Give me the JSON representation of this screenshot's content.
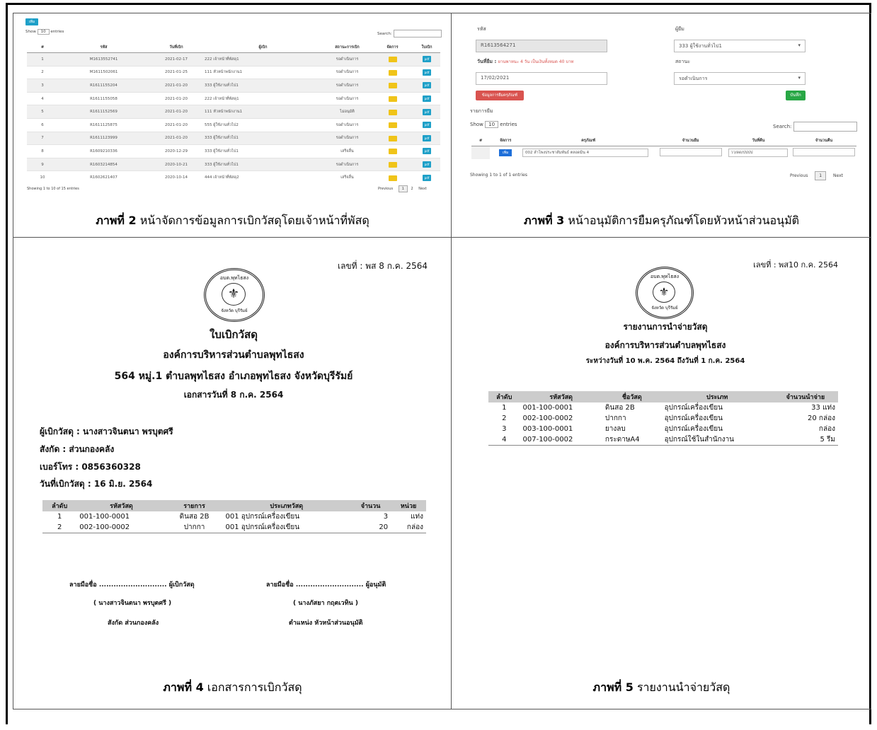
{
  "captions": [
    {
      "num": "ภาพที่ 2",
      "text": " หน้าจัดการข้อมูลการเบิกวัสดุโดยเจ้าหน้าที่พัสดุ"
    },
    {
      "num": "ภาพที่ 3",
      "text": " หน้าอนุมัติการยืมครุภัณฑ์โดยหัวหน้าส่วนอนุมัติ"
    },
    {
      "num": "ภาพที่ 4",
      "text": " เอกสารการเบิกวัสดุ"
    },
    {
      "num": "ภาพที่ 5",
      "text": " รายงานนำจ่ายวัสดุ"
    }
  ],
  "fig2": {
    "add_button": "เพิ่ม",
    "show_label": "Show",
    "show_value": "10",
    "entries_label": "entries",
    "search_label": "Search:",
    "columns": [
      "#",
      "รหัส",
      "วันที่เบิก",
      "ผู้เบิก",
      "สถานะการเบิก",
      "จัดการ",
      "ใบเบิก"
    ],
    "rows": [
      [
        "1",
        "M1613552741",
        "2021-02-17",
        "222 เจ้าหน้าที่พัสดุ1",
        "รอดำเนินการ"
      ],
      [
        "2",
        "M1611502061",
        "2021-01-25",
        "111 หัวหน้าพนักงาน1",
        "รอดำเนินการ"
      ],
      [
        "3",
        "R1611155204",
        "2021-01-20",
        "333 ผู้ใช้งานทั่วไป1",
        "รอดำเนินการ"
      ],
      [
        "4",
        "R1611155058",
        "2021-01-20",
        "222 เจ้าหน้าที่พัสดุ1",
        "รอดำเนินการ"
      ],
      [
        "5",
        "R1611152569",
        "2021-01-20",
        "111 หัวหน้าพนักงาน1",
        "ไม่อนุมัติ"
      ],
      [
        "6",
        "R1611125875",
        "2021-01-20",
        "555 ผู้ใช้งานทั่วไป2",
        "รอดำเนินการ"
      ],
      [
        "7",
        "R1611123999",
        "2021-01-20",
        "333 ผู้ใช้งานทั่วไป1",
        "รอดำเนินการ"
      ],
      [
        "8",
        "R1609210336",
        "2020-12-29",
        "333 ผู้ใช้งานทั่วไป1",
        "เสร็จสิ้น"
      ],
      [
        "9",
        "R1603214854",
        "2020-10-21",
        "333 ผู้ใช้งานทั่วไป1",
        "รอดำเนินการ"
      ],
      [
        "10",
        "R1602621407",
        "2020-10-14",
        "444 เจ้าหน้าที่พัสดุ2",
        "เสร็จสิ้น"
      ]
    ],
    "manage_btn": "แก้ไข",
    "pdf_btn": "pdf",
    "footer_info": "Showing 1 to 10 of 15 entries",
    "pager": {
      "prev": "Previous",
      "p1": "1",
      "p2": "2",
      "next": "Next"
    }
  },
  "fig3": {
    "code_label": "รหัส",
    "code_value": "R1613564271",
    "borrower_label": "ผู้ยืม",
    "borrower_value": "333 ผู้ใช้งานทั่วไป1",
    "date_label": "วันที่ยืม :",
    "date_note": "ยานพาหนะ 4 วัน เป็นเงินทั้งหมด 40 บาท",
    "date_value": "17/02/2021",
    "status_label": "สถานะ",
    "status_value": "รอดำเนินการ",
    "red_button": "ข้อมูลการยืมครุภัณฑ์",
    "save_button": "บันทึก",
    "list_label": "รายการยืม",
    "show_label": "Show",
    "show_value": "10",
    "entries_label": "entries",
    "search_label": "Search:",
    "columns": [
      "#",
      "จัดการ",
      "ครุภัณฑ์",
      "จำนวนยืม",
      "วันที่คืน",
      "จำนวนคืน"
    ],
    "row": {
      "btn": "เพิ่ม",
      "item": "002 ลำโพงประชาสัมพันธ์ ตลอดมิน 4",
      "return_date": "วว/ดด/ปปปป"
    },
    "footer_info": "Showing 1 to 1 of 1 entries",
    "pager": {
      "prev": "Previous",
      "p1": "1",
      "next": "Next"
    }
  },
  "fig4": {
    "doc_no": "เลขที่ : พส 8 ก.ค. 2564",
    "seal_top": "อบต.พุทไธสง",
    "seal_bottom": "จังหวัด บุรีรัมย์",
    "title": "ใบเบิกวัสดุ",
    "org": "องค์การบริหารส่วนตำบลพุทไธสง",
    "address": "564 หมู่.1 ตำบลพุทไธสง อำเภอพุทไธสง จังหวัดบุรีรัมย์",
    "doc_date": "เอกสารวันที่ 8 ก.ค. 2564",
    "requester": "ผู้เบิกวัสดุ : นางสาวจินตนา พรบุตศรี",
    "dept": "สังกัด : ส่วนกองคลัง",
    "phone": "เบอร์โทร : 0856360328",
    "req_date": "วันที่เบิกวัสดุ : 16 มิ.ย. 2564",
    "columns": [
      "ลำดับ",
      "รหัสวัสดุ",
      "รายการ",
      "ประเภทวัสดุ",
      "จำนวน",
      "หน่วย"
    ],
    "rows": [
      [
        "1",
        "001-100-0001",
        "ดินสอ 2B",
        "001 อุปกรณ์เครื่องเขียน",
        "3",
        "แท่ง"
      ],
      [
        "2",
        "002-100-0002",
        "ปากกา",
        "001 อุปกรณ์เครื่องเขียน",
        "20",
        "กล่อง"
      ]
    ],
    "sign_left": "ลายมือชื่อ ............................ ผู้เบิกวัสดุ",
    "sign_left_name": "( นางสาวจินตนา พรบุตศรี )",
    "sign_left_pos": "สังกัด ส่วนกองคลัง",
    "sign_right": "ลายมือชื่อ ............................ ผู้อนุมัติ",
    "sign_right_name": "( นางภัสยา กฤตเวทิน )",
    "sign_right_pos": "ตำแหน่ง หัวหน้าส่วนอนุมัติ"
  },
  "fig5": {
    "doc_no": "เลขที่ : พส10 ก.ค. 2564",
    "seal_top": "อบต.พุทไธสง",
    "seal_bottom": "จังหวัด บุรีรัมย์",
    "title": "รายงานการนำจ่ายวัสดุ",
    "org": "องค์การบริหารส่วนตำบลพุทไธสง",
    "period": "ระหว่างวันที่ 10 พ.ค. 2564 ถึงวันที่ 1 ก.ค. 2564",
    "columns": [
      "ลำดับ",
      "รหัสวัสดุ",
      "ชื่อวัสดุ",
      "ประเภท",
      "จำนวนนำจ่าย"
    ],
    "rows": [
      [
        "1",
        "001-100-0001",
        "ดินสอ 2B",
        "อุปกรณ์เครื่องเขียน",
        "33 แท่ง"
      ],
      [
        "2",
        "002-100-0002",
        "ปากกา",
        "อุปกรณ์เครื่องเขียน",
        "20 กล่อง"
      ],
      [
        "3",
        "003-100-0001",
        "ยางลบ",
        "อุปกรณ์เครื่องเขียน",
        "กล่อง"
      ],
      [
        "4",
        "007-100-0002",
        "กระดาษA4",
        "อุปกรณ์ใช้ในสำนักงาน",
        "5 รีม"
      ]
    ]
  }
}
